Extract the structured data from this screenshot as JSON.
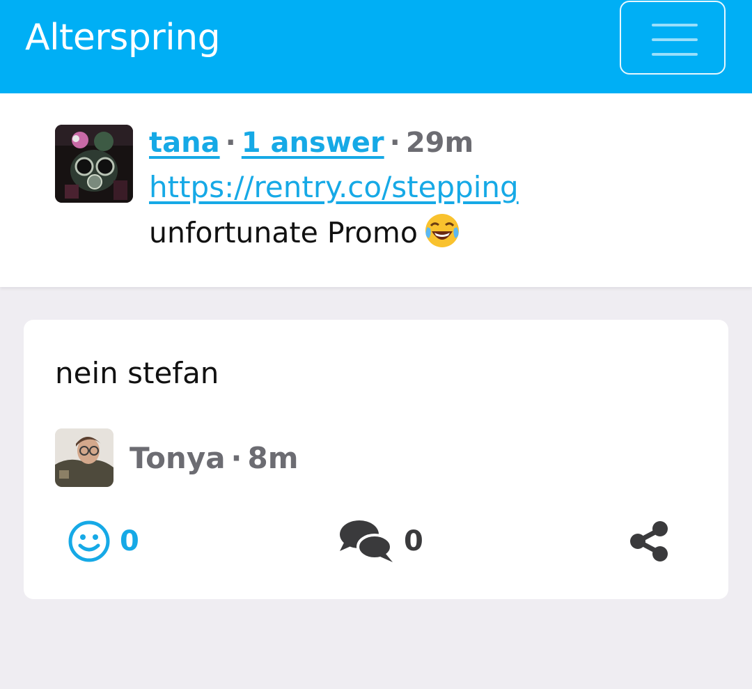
{
  "app": {
    "title": "Alterspring"
  },
  "colors": {
    "accent": "#00aff5",
    "link": "#16a9e6",
    "muted": "#6c6c72",
    "background": "#efedf2"
  },
  "navbar": {
    "menu_icon": "hamburger-menu-icon"
  },
  "question": {
    "author": "tana",
    "answers_link": "1 answer",
    "time": "29m",
    "link": "https://rentry.co/stepping",
    "text": "unfortunate Promo",
    "emoji": "face-with-tears-of-joy-emoji"
  },
  "answer": {
    "text": "nein stefan",
    "author": "Tonya",
    "time": "8m",
    "reactions": {
      "icon": "smiley-icon",
      "count": "0"
    },
    "comments": {
      "icon": "comments-icon",
      "count": "0"
    },
    "share": {
      "icon": "share-icon"
    }
  }
}
